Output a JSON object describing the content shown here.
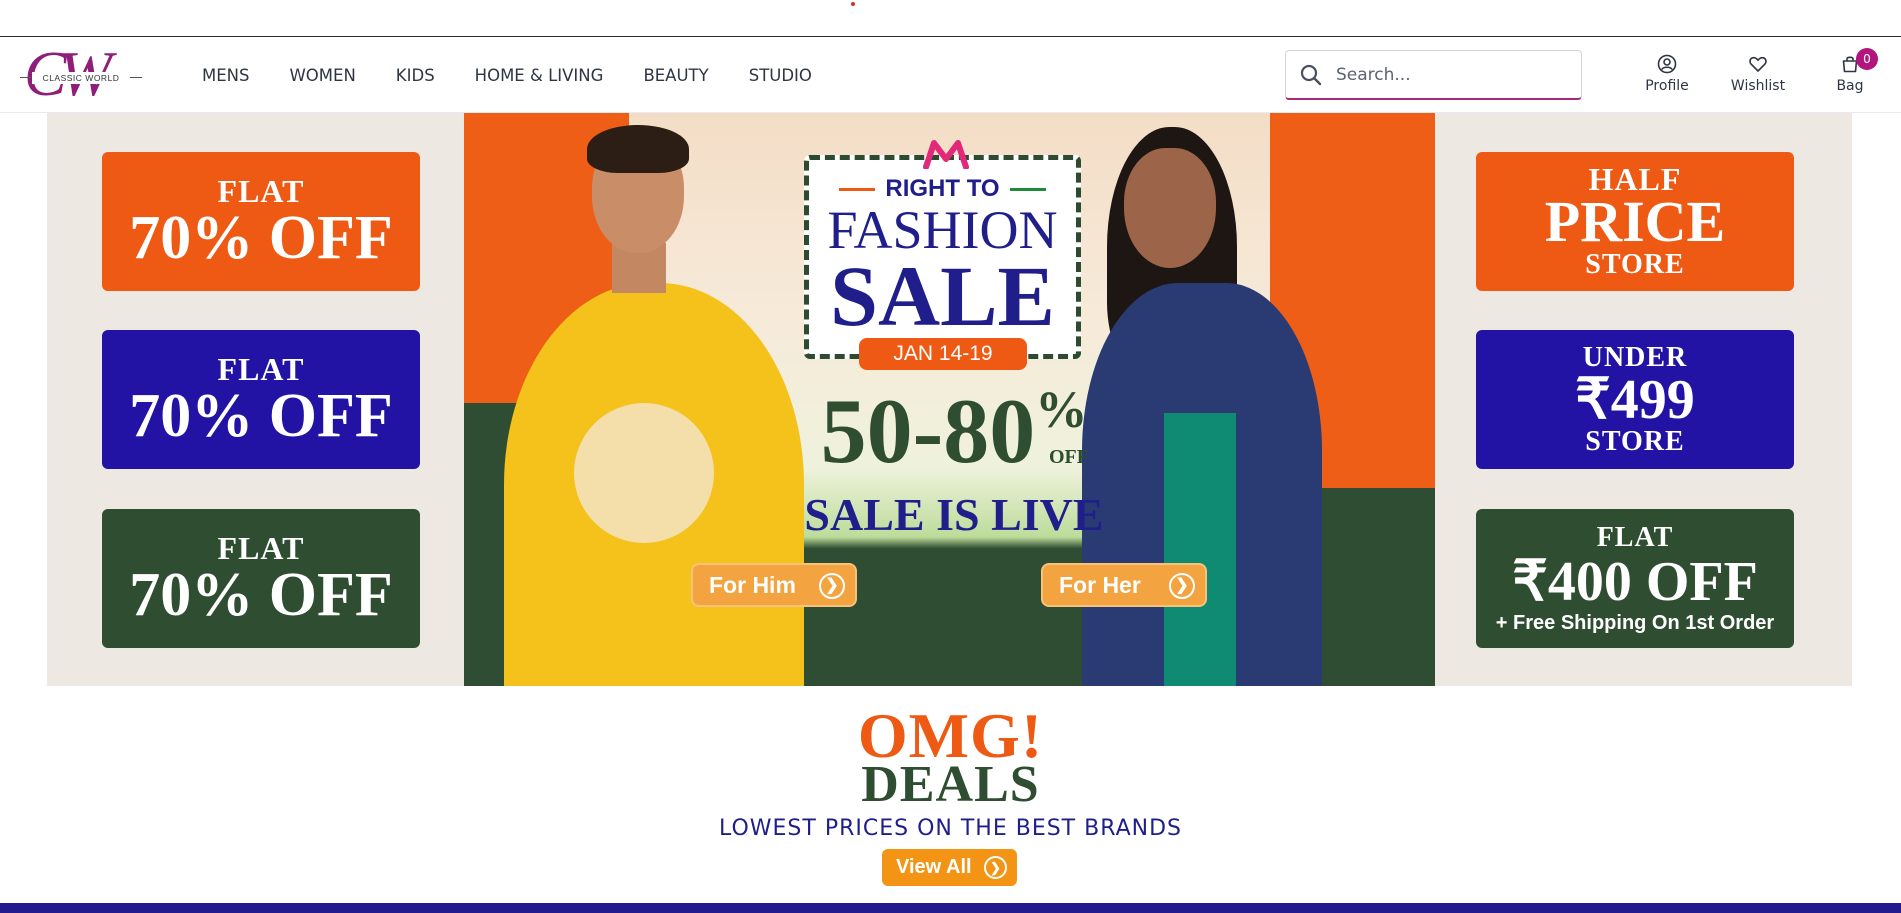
{
  "brand": {
    "logo_letters": "CW",
    "logo_text": "CLASSIC WORLD",
    "accent_color": "#8f1d7a"
  },
  "nav": {
    "items": [
      {
        "label": "MENS"
      },
      {
        "label": "WOMEN"
      },
      {
        "label": "KIDS"
      },
      {
        "label": "HOME & LIVING"
      },
      {
        "label": "BEAUTY"
      },
      {
        "label": "STUDIO"
      }
    ]
  },
  "search": {
    "placeholder": "Search..."
  },
  "actions": {
    "profile_label": "Profile",
    "wishlist_label": "Wishlist",
    "bag_label": "Bag",
    "bag_count": "0"
  },
  "hero": {
    "left_tiles": [
      {
        "line1": "FLAT",
        "line2": "70% OFF",
        "color": "#ee5a14"
      },
      {
        "line1": "FLAT",
        "line2": "70% OFF",
        "color": "#2213a5"
      },
      {
        "line1": "FLAT",
        "line2": "70% OFF",
        "color": "#2e4d31"
      }
    ],
    "right_tiles": [
      {
        "line1": "HALF",
        "line2": "PRICE",
        "line3": "STORE",
        "color": "#ee5a14"
      },
      {
        "line1": "UNDER",
        "line2": "₹499",
        "line3": "STORE",
        "color": "#2213a5"
      },
      {
        "line1": "FLAT",
        "line2": "₹400 OFF",
        "line3": "+ Free Shipping On 1st Order",
        "color": "#2e4d31"
      }
    ],
    "center": {
      "tagline": "RIGHT TO",
      "title_line1": "FASHION",
      "title_line2": "SALE",
      "dates": "JAN 14-19",
      "discount": "50-80",
      "percent_sign": "%",
      "off": "OFF",
      "status": "SALE IS LIVE",
      "cta_him": "For Him",
      "cta_her": "For Her"
    }
  },
  "deals": {
    "headline1": "OMG!",
    "headline2": "DEALS",
    "subtitle": "LOWEST PRICES ON THE BEST BRANDS",
    "button_label": "View All"
  }
}
